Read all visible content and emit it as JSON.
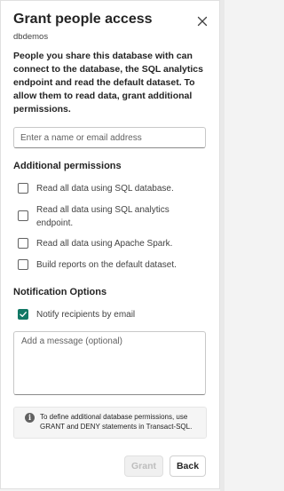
{
  "dialog": {
    "title": "Grant people access",
    "subtitle": "dbdemos",
    "description": "People you share this database with can connect to the database, the SQL analytics endpoint and read the default dataset. To allow them to read data, grant additional permissions.",
    "email_placeholder": "Enter a name or email address"
  },
  "additional_permissions": {
    "heading": "Additional permissions",
    "items": [
      {
        "label": "Read all data using SQL database.",
        "checked": false
      },
      {
        "label": "Read all data using SQL analytics endpoint.",
        "checked": false
      },
      {
        "label": "Read all data using Apache Spark.",
        "checked": false
      },
      {
        "label": "Build reports on the default dataset.",
        "checked": false
      }
    ]
  },
  "notification": {
    "heading": "Notification Options",
    "notify_label": "Notify recipients by email",
    "notify_checked": true,
    "message_placeholder": "Add a message (optional)"
  },
  "info": {
    "icon": "info-icon",
    "text": "To define additional database permissions, use GRANT and DENY statements in Transact-SQL."
  },
  "footer": {
    "grant_label": "Grant",
    "back_label": "Back"
  },
  "colors": {
    "accent": "#117865",
    "panel": "#ffffff"
  }
}
